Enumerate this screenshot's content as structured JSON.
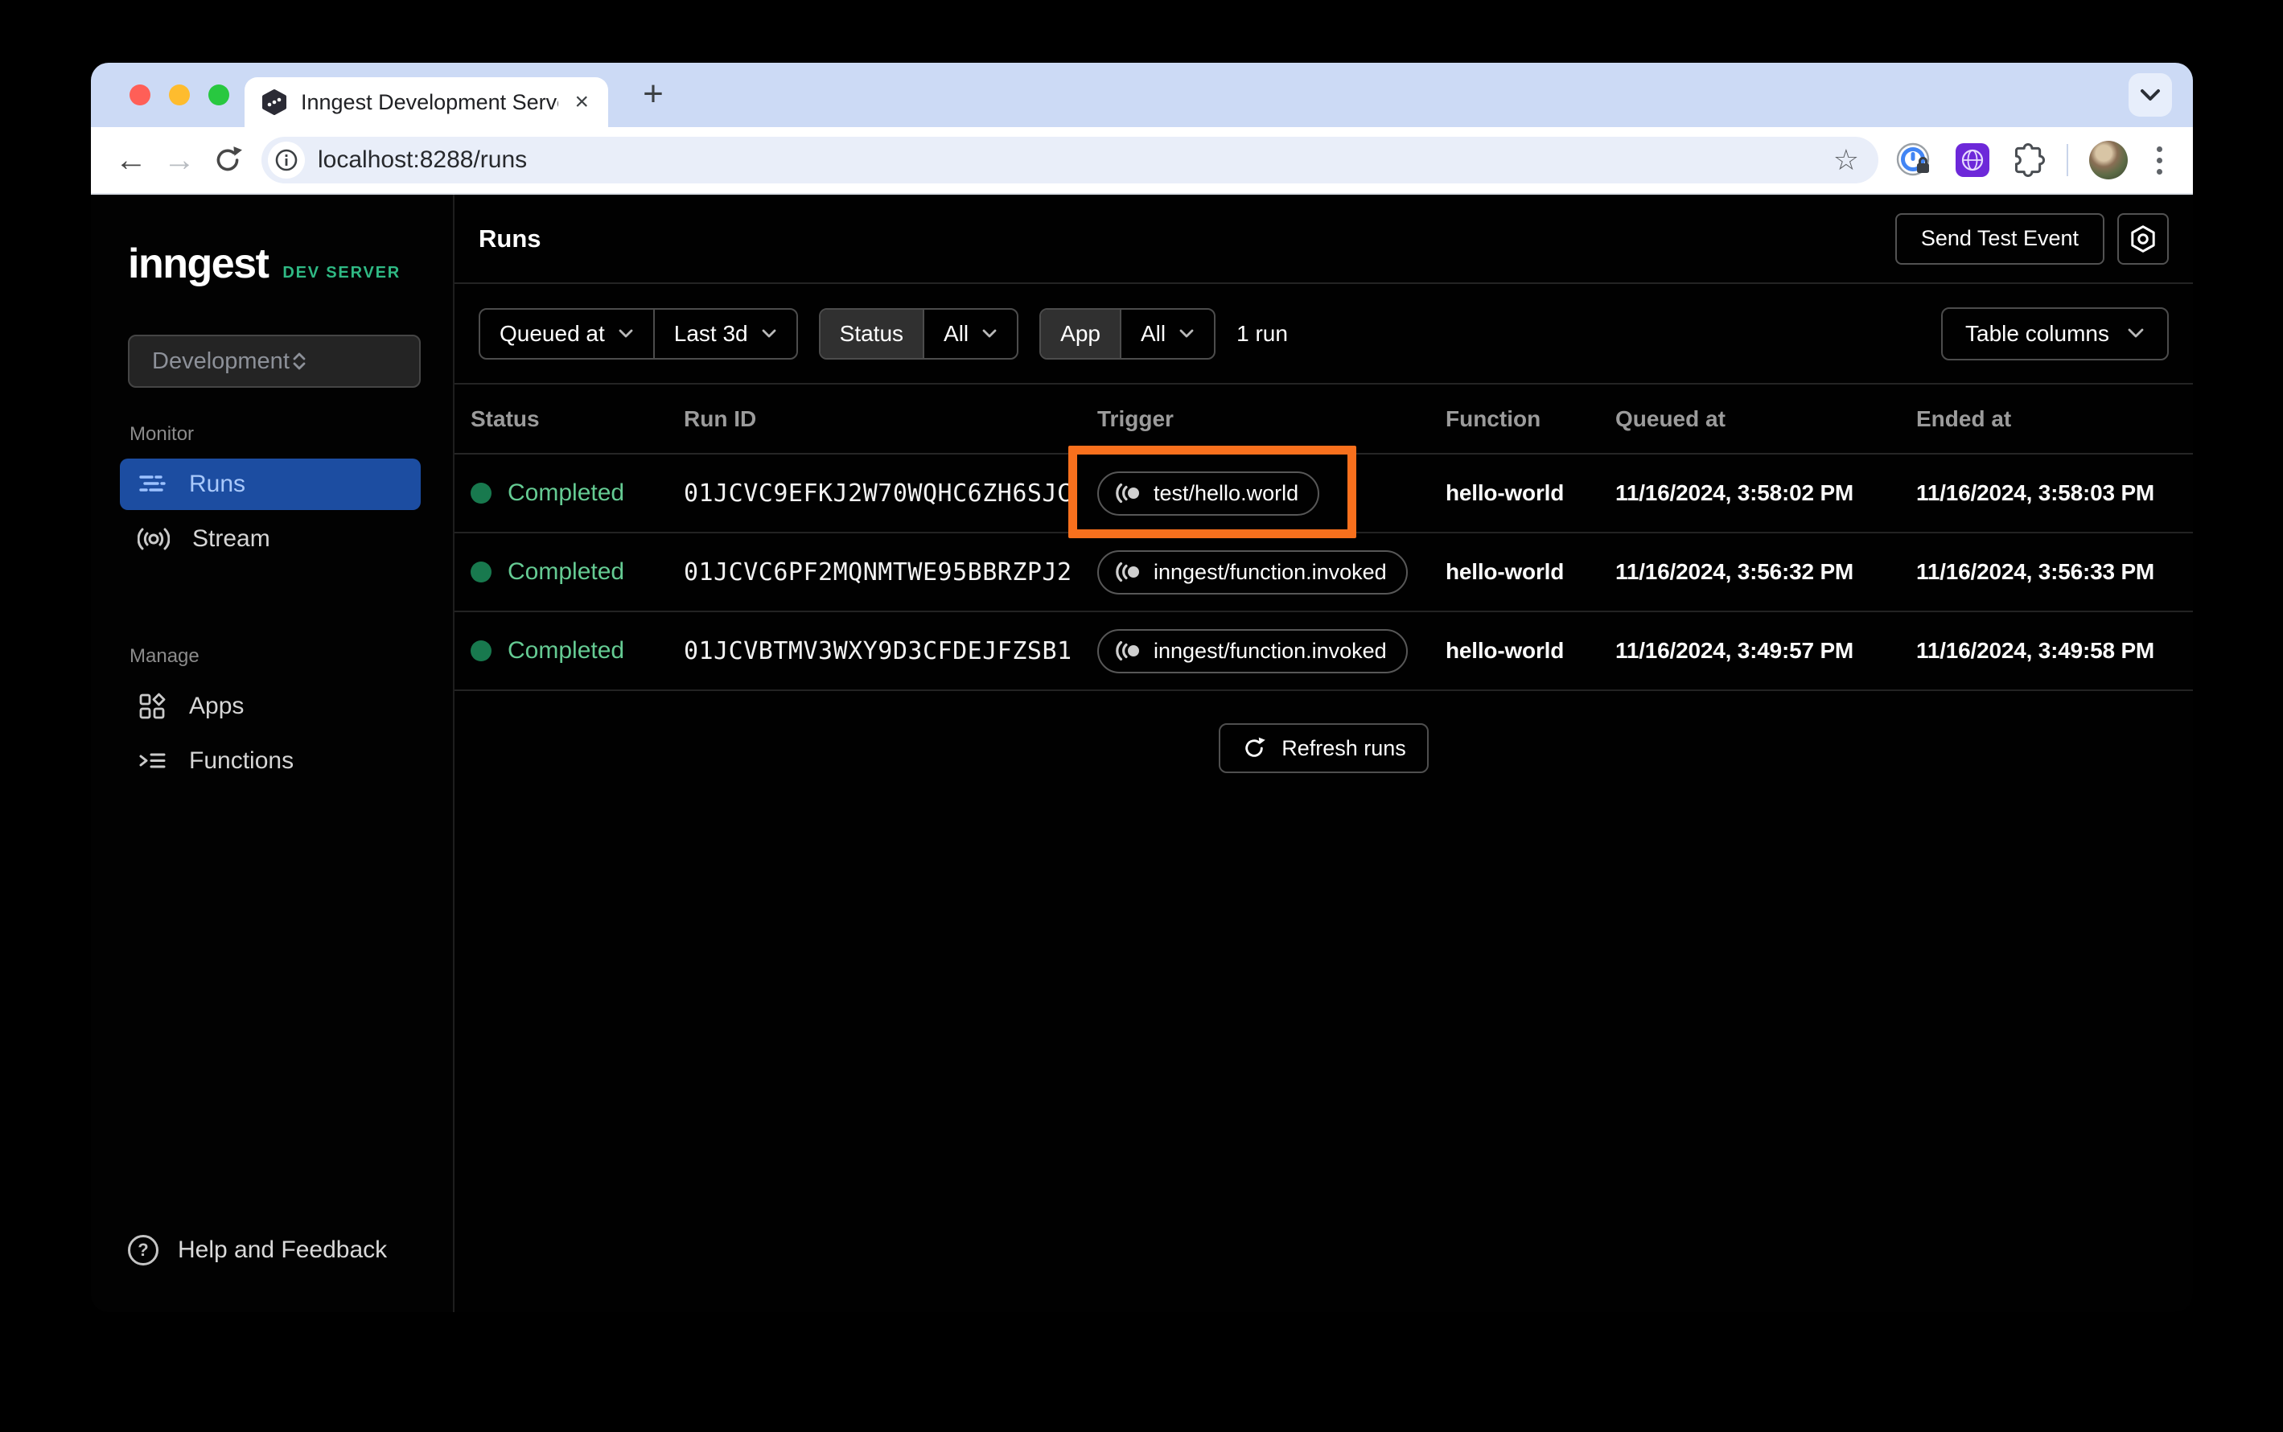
{
  "browser": {
    "tab_title": "Inngest Development Server",
    "url": "localhost:8288/runs",
    "close_glyph": "×",
    "new_tab_glyph": "+",
    "back_glyph": "←",
    "forward_glyph": "→",
    "star_glyph": "☆"
  },
  "sidebar": {
    "logo": "inngest",
    "logo_badge": "DEV SERVER",
    "env_select_value": "Development",
    "sections": [
      {
        "label": "Monitor",
        "items": [
          {
            "label": "Runs",
            "active": true
          },
          {
            "label": "Stream",
            "active": false
          }
        ]
      },
      {
        "label": "Manage",
        "items": [
          {
            "label": "Apps",
            "active": false
          },
          {
            "label": "Functions",
            "active": false
          }
        ]
      }
    ],
    "help_label": "Help and Feedback",
    "help_glyph": "?"
  },
  "header": {
    "title": "Runs",
    "send_test_event_label": "Send Test Event"
  },
  "filters": {
    "queued_at_label": "Queued at",
    "time_range_value": "Last 3d",
    "status_label": "Status",
    "status_value": "All",
    "app_label": "App",
    "app_value": "All",
    "run_count": "1 run",
    "table_columns_label": "Table columns"
  },
  "table": {
    "columns": [
      "Status",
      "Run ID",
      "Trigger",
      "Function",
      "Queued at",
      "Ended at"
    ],
    "rows": [
      {
        "status": "Completed",
        "run_id": "01JCVC9EFKJ2W70WQHC6ZH6SJC",
        "trigger": "test/hello.world",
        "function": "hello-world",
        "queued_at": "11/16/2024, 3:58:02 PM",
        "ended_at": "11/16/2024, 3:58:03 PM"
      },
      {
        "status": "Completed",
        "run_id": "01JCVC6PF2MQNMTWE95BBRZPJ2",
        "trigger": "inngest/function.invoked",
        "function": "hello-world",
        "queued_at": "11/16/2024, 3:56:32 PM",
        "ended_at": "11/16/2024, 3:56:33 PM"
      },
      {
        "status": "Completed",
        "run_id": "01JCVBTMV3WXY9D3CFDEJFZSB1",
        "trigger": "inngest/function.invoked",
        "function": "hello-world",
        "queued_at": "11/16/2024, 3:49:57 PM",
        "ended_at": "11/16/2024, 3:49:58 PM"
      }
    ],
    "refresh_label": "Refresh runs"
  },
  "colors": {
    "highlight_orange": "#f8701d",
    "active_nav_blue": "#1c4da1",
    "status_green_dot": "#18794e",
    "status_green_text": "#65cb93",
    "dev_server_green": "#2fb984",
    "tabstrip_blue": "#ccdaf5"
  }
}
